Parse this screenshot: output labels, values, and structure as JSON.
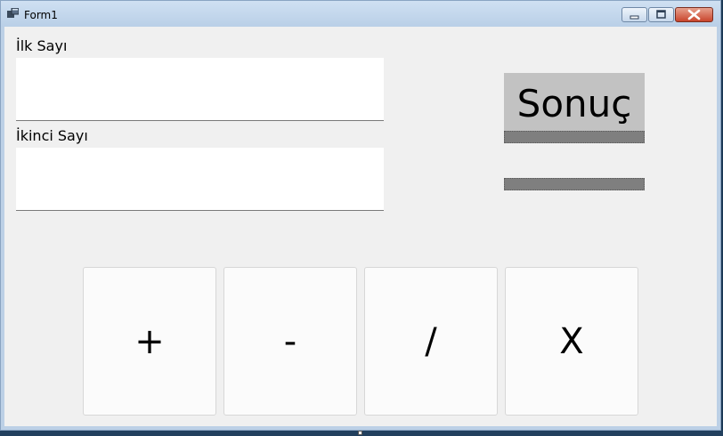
{
  "window": {
    "title": "Form1"
  },
  "form": {
    "first_label": "İlk Sayı",
    "second_label": "İkinci Sayı",
    "first_value": "",
    "second_value": "",
    "result_label": "Sonuç"
  },
  "buttons": {
    "add": "+",
    "subtract": "-",
    "divide": "/",
    "multiply": "X"
  },
  "icons": {
    "app": "form-app-icon",
    "minimize": "minimize-icon",
    "maximize": "maximize-icon",
    "close": "close-icon"
  }
}
